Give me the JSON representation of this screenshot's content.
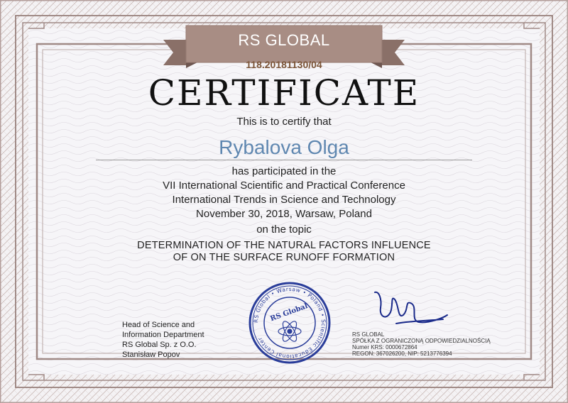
{
  "brand": "RS GLOBAL",
  "certificate_number": "118.20181130/04",
  "title": "CERTIFICATE",
  "certify_text": "This is to certify that",
  "recipient": "Rybalova Olga",
  "participated": "has participated in the",
  "conference_name": "VII International Scientific and Practical Conference",
  "conference_title": "International Trends in Science and Technology",
  "conference_date": "November 30, 2018, Warsaw, Poland",
  "topic_label": "on the topic",
  "topic_line1": "DETERMINATION OF THE NATURAL FACTORS INFLUENCE",
  "topic_line2": "OF ON THE SURFACE RUNOFF FORMATION",
  "signatory": {
    "line1": "Head of Science and",
    "line2": "Information Department",
    "line3": "RS Global Sp. z O.O.",
    "line4": "Stanisław Popov"
  },
  "company": {
    "line1": "RS GLOBAL",
    "line2": "SPÓŁKA Z OGRANICZONĄ ODPOWIEDZIALNOŚCIĄ",
    "line3": "Numer KRS: 0000672864",
    "line4": "REGON: 367026200, NIP: 5213776394"
  },
  "stamp_text": {
    "ring": "RS Global • Warsaw • Poland • Scientific Educational Center",
    "center": "RS Global"
  },
  "colors": {
    "frame": "#a08a86",
    "ribbon": "#a88d84",
    "ribbon_dark": "#8a7068",
    "recipient": "#5f87b0",
    "stamp": "#2a3d9a",
    "signature": "#1a2a8a"
  }
}
